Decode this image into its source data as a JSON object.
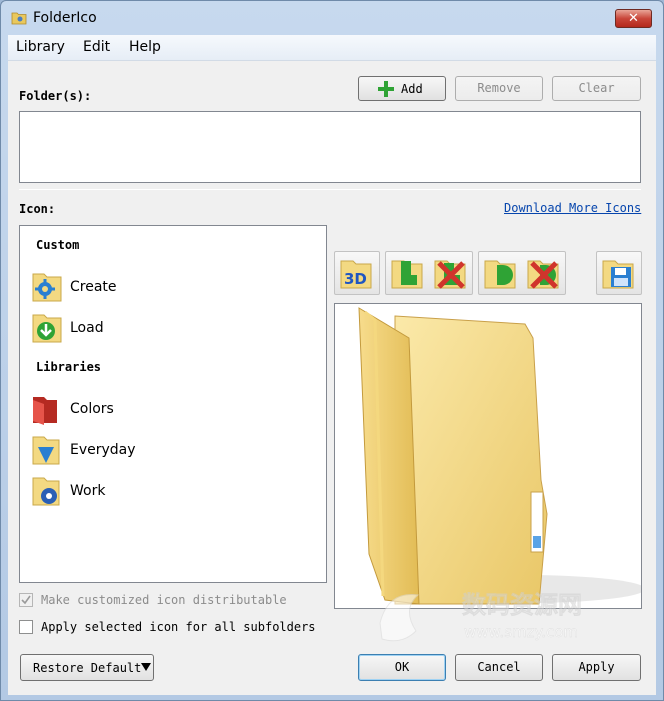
{
  "window": {
    "title": "FolderIco",
    "close_glyph": "✕"
  },
  "menu": {
    "items": [
      "Library",
      "Edit",
      "Help"
    ]
  },
  "folders": {
    "label": "Folder(s):",
    "add_label": "Add",
    "remove_label": "Remove",
    "clear_label": "Clear",
    "value": ""
  },
  "icon": {
    "label": "Icon:",
    "download_link": "Download More Icons",
    "toolbar_3d": "3D"
  },
  "library": {
    "custom_heading": "Custom",
    "create_label": "Create",
    "load_label": "Load",
    "libraries_heading": "Libraries",
    "colors_label": "Colors",
    "everyday_label": "Everyday",
    "work_label": "Work"
  },
  "options": {
    "distributable_label": "Make customized icon distributable",
    "distributable_checked": true,
    "distributable_enabled": false,
    "subfolders_label": "Apply selected icon for all subfolders",
    "subfolders_checked": false
  },
  "footer": {
    "restore_label": "Restore Default",
    "ok_label": "OK",
    "cancel_label": "Cancel",
    "apply_label": "Apply"
  },
  "watermark": {
    "text_cn": "数码资源网",
    "text_url": "www.smzy.com"
  },
  "colors": {
    "accent": "#3c7fb1",
    "link": "#0645ad",
    "folder": "#f3d982",
    "red": "#d0342c",
    "green": "#2fa335"
  }
}
